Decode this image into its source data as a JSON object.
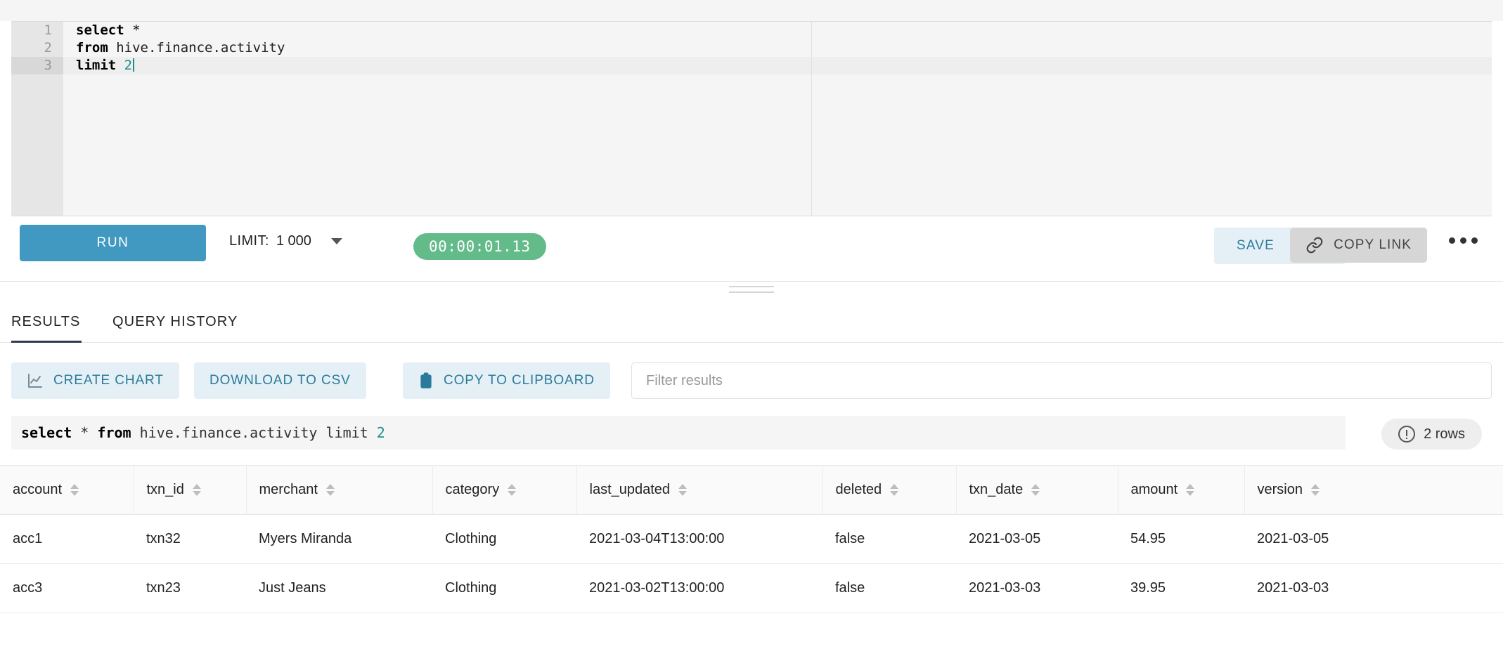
{
  "editor": {
    "lines": [
      {
        "num": "1",
        "tokens": [
          {
            "t": "select",
            "c": "kw"
          },
          {
            "t": " ",
            "c": "pl"
          },
          {
            "t": "*",
            "c": "op"
          }
        ]
      },
      {
        "num": "2",
        "tokens": [
          {
            "t": "from",
            "c": "kw"
          },
          {
            "t": " hive.finance.activity",
            "c": "pl"
          }
        ]
      },
      {
        "num": "3",
        "tokens": [
          {
            "t": "limit",
            "c": "kw"
          },
          {
            "t": " ",
            "c": "pl"
          },
          {
            "t": "2",
            "c": "num"
          }
        ]
      }
    ],
    "line1": "select *",
    "line2": "from hive.finance.activity",
    "line3": "limit 2",
    "active_line": "3"
  },
  "toolbar": {
    "run_label": "RUN",
    "limit_label": "LIMIT:",
    "limit_value": "1 000",
    "timer": "00:00:01.13",
    "save_label": "SAVE",
    "copy_link_label": "COPY LINK",
    "more_label": "more-options",
    "run_color": "#4199c1",
    "timer_color": "#64bb8a",
    "accent_color": "#2c7a9b"
  },
  "tabs": {
    "results_label": "RESULTS",
    "history_label": "QUERY HISTORY",
    "active": "RESULTS",
    "underline_color": "#2e3a52"
  },
  "result_actions": {
    "create_chart_label": "CREATE CHART",
    "download_csv_label": "DOWNLOAD TO CSV",
    "copy_clipboard_label": "COPY TO CLIPBOARD",
    "filter_placeholder": "Filter results",
    "filter_value": ""
  },
  "query_bar": {
    "parts": [
      {
        "t": "select",
        "c": "kw"
      },
      {
        "t": " * ",
        "c": "pl"
      },
      {
        "t": "from",
        "c": "kw"
      },
      {
        "t": " hive.finance.activity limit ",
        "c": "pl"
      },
      {
        "t": "2",
        "c": "num"
      }
    ],
    "full_text": "select * from hive.finance.activity limit 2",
    "rows_badge": "2 rows"
  },
  "table": {
    "columns": [
      "account",
      "txn_id",
      "merchant",
      "category",
      "last_updated",
      "deleted",
      "txn_date",
      "amount",
      "version"
    ],
    "rows": [
      {
        "account": "acc1",
        "txn_id": "txn32",
        "merchant": "Myers Miranda",
        "category": "Clothing",
        "last_updated": "2021-03-04T13:00:00",
        "deleted": "false",
        "txn_date": "2021-03-05",
        "amount": "54.95",
        "version": "2021-03-05"
      },
      {
        "account": "acc3",
        "txn_id": "txn23",
        "merchant": "Just Jeans",
        "category": "Clothing",
        "last_updated": "2021-03-02T13:00:00",
        "deleted": "false",
        "txn_date": "2021-03-03",
        "amount": "39.95",
        "version": "2021-03-03"
      }
    ]
  }
}
